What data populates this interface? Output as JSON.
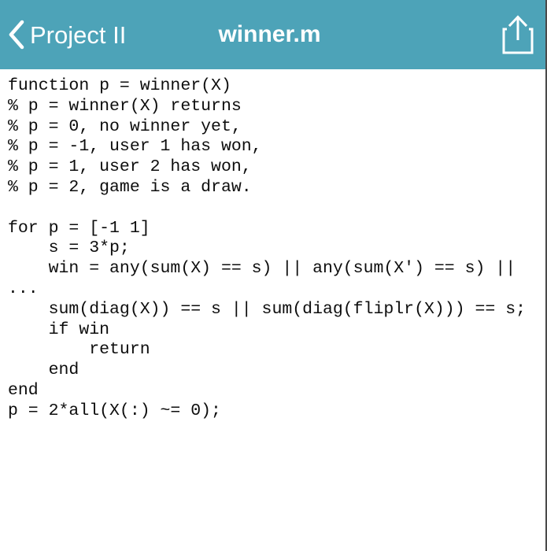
{
  "navbar": {
    "back_label": "Project II",
    "back_icon": "chevron-left-icon",
    "title": "winner.m",
    "share_icon": "share-export-icon",
    "background_color": "#4da3b8",
    "text_color": "#ffffff"
  },
  "editor": {
    "filename": "winner.m",
    "language": "matlab",
    "text_color": "#0d0d0d",
    "background_color": "#ffffff",
    "code": "function p = winner(X)\n% p = winner(X) returns\n% p = 0, no winner yet,\n% p = -1, user 1 has won,\n% p = 1, user 2 has won,\n% p = 2, game is a draw.\n\nfor p = [-1 1]\n    s = 3*p;\n    win = any(sum(X) == s) || any(sum(X') == s) || ...\n    sum(diag(X)) == s || sum(diag(fliplr(X))) == s;\n    if win\n        return\n    end\nend\np = 2*all(X(:) ~= 0);\n",
    "lines": [
      "function p = winner(X)",
      "% p = winner(X) returns",
      "% p = 0, no winner yet,",
      "% p = -1, user 1 has won,",
      "% p = 1, user 2 has won,",
      "% p = 2, game is a draw.",
      "",
      "for p = [-1 1]",
      "    s = 3*p;",
      "    win = any(sum(X) == s) || any(sum(X') == s) || ...",
      "    sum(diag(X)) == s || sum(diag(fliplr(X))) == s;",
      "    if win",
      "        return",
      "    end",
      "end",
      "p = 2*all(X(:) ~= 0);"
    ]
  }
}
